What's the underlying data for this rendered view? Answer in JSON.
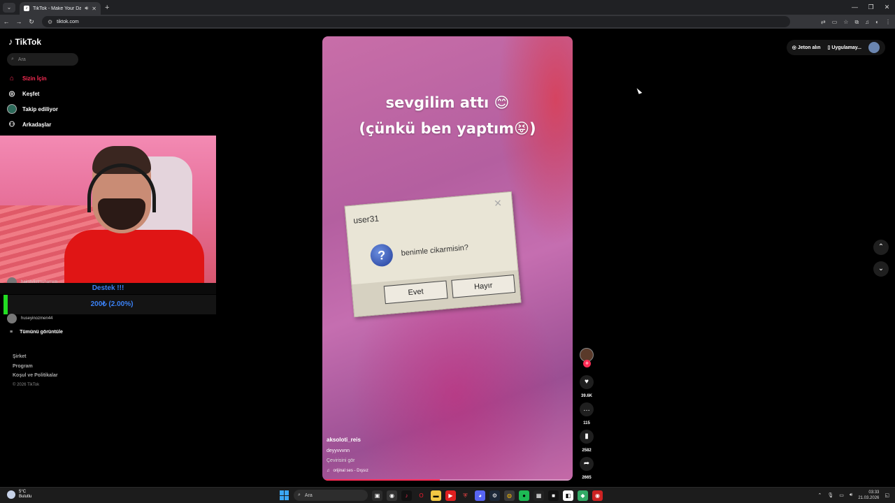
{
  "browser": {
    "tab_title": "TikTok - Make Your Day",
    "url": "tiktok.com"
  },
  "sidebar": {
    "logo": "TikTok",
    "search_placeholder": "Ara",
    "nav": [
      {
        "label": "Sizin İçin",
        "icon": "home-icon"
      },
      {
        "label": "Keşfet",
        "icon": "compass-icon"
      },
      {
        "label": "Takip ediliyor",
        "icon": "following-avatar"
      },
      {
        "label": "Arkadaşlar",
        "icon": "friends-icon"
      }
    ],
    "suggested": [
      {
        "name": "hairstylistmuharrem"
      },
      {
        "name": "huseyinozmen44"
      }
    ],
    "see_all": "Tümünü görüntüle",
    "footer": [
      "Şirket",
      "Program",
      "Koşul ve Politikalar"
    ],
    "copyright": "© 2026 TikTok"
  },
  "donation": {
    "title": "Destek !!!",
    "amount": "200₺ (2.00%)",
    "progress_percent": 2
  },
  "video": {
    "caption_line1": "sevgilim attı 😊",
    "caption_line2": "(çünkü ben yaptım😝)",
    "dialog": {
      "title": "user31",
      "message": "benimle cikarmisin?",
      "yes": "Evet",
      "no": "Hayır"
    },
    "author": "aksoloti_reis",
    "description": "deyyvvvnn",
    "translate": "Çevirisini gör",
    "sound": "orijinal ses - Dışsız",
    "progress_percent": 47
  },
  "actions": {
    "likes": "39.6K",
    "comments": "115",
    "saves": "2582",
    "shares": "2665"
  },
  "topright": {
    "coins": "Jeton alın",
    "app": "Uygulamay..."
  },
  "taskbar": {
    "temp": "5°C",
    "condition": "Bulutlu",
    "search": "Ara",
    "time": "03:33",
    "date": "21.03.2026"
  }
}
